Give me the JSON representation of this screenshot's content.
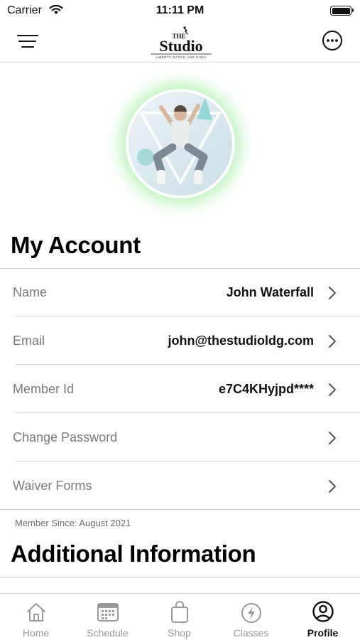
{
  "status_bar": {
    "carrier": "Carrier",
    "time": "11:11 PM"
  },
  "header": {
    "logo_text": "The Studio",
    "logo_tagline": "LIBERTY DANCE AND GUES"
  },
  "account": {
    "title": "My Account",
    "rows": [
      {
        "label": "Name",
        "value": "John Waterfall"
      },
      {
        "label": "Email",
        "value": "john@thestudioldg.com"
      },
      {
        "label": "Member Id",
        "value": "e7C4KHyjpd****"
      },
      {
        "label": "Change Password",
        "value": ""
      },
      {
        "label": "Waiver Forms",
        "value": ""
      }
    ],
    "member_since": "Member Since: August 2021"
  },
  "additional": {
    "title": "Additional Information"
  },
  "tab_bar": {
    "tabs": [
      {
        "label": "Home",
        "icon": "home-icon"
      },
      {
        "label": "Schedule",
        "icon": "calendar-icon"
      },
      {
        "label": "Shop",
        "icon": "shopping-bag-icon"
      },
      {
        "label": "Classes",
        "icon": "lightning-icon"
      },
      {
        "label": "Profile",
        "icon": "profile-icon"
      }
    ],
    "active": "Profile"
  },
  "colors": {
    "avatar_glow": "#82e682",
    "inactive_tab": "#9a9a9a",
    "label_gray": "#7a7a7a"
  }
}
